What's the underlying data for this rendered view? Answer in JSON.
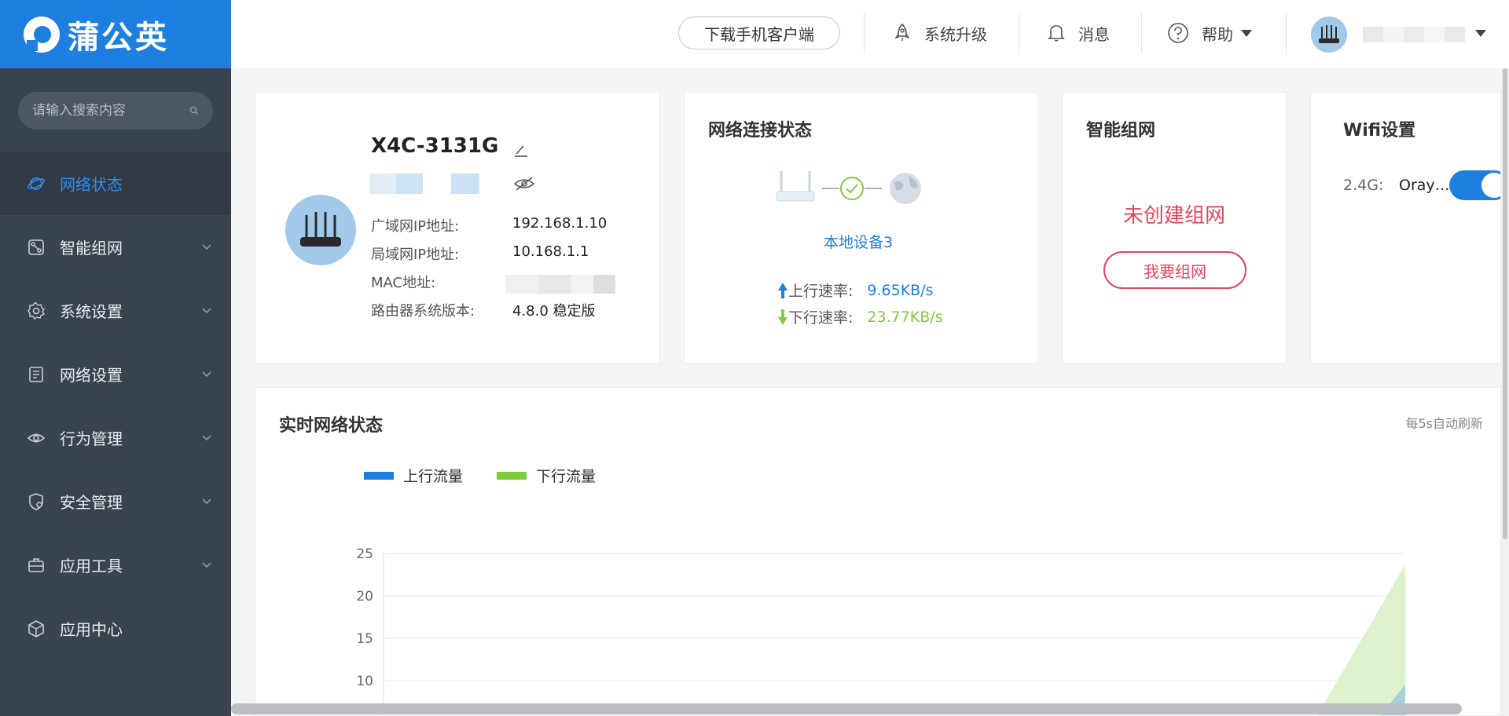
{
  "brand": {
    "name": "蒲公英"
  },
  "sidebar": {
    "search_placeholder": "请输入搜索内容",
    "items": [
      {
        "label": "网络状态",
        "icon": "planet-icon",
        "active": true
      },
      {
        "label": "智能组网",
        "icon": "mesh-icon"
      },
      {
        "label": "系统设置",
        "icon": "gear-icon"
      },
      {
        "label": "网络设置",
        "icon": "document-icon"
      },
      {
        "label": "行为管理",
        "icon": "eye-icon"
      },
      {
        "label": "安全管理",
        "icon": "shield-gear-icon"
      },
      {
        "label": "应用工具",
        "icon": "briefcase-icon"
      },
      {
        "label": "应用中心",
        "icon": "cube-icon"
      }
    ]
  },
  "header": {
    "download_label": "下载手机客户端",
    "upgrade_label": "系统升级",
    "messages_label": "消息",
    "help_label": "帮助"
  },
  "device_card": {
    "name": "X4C-3131G",
    "wan_label": "广域网IP地址:",
    "wan_value": "192.168.1.10",
    "lan_label": "局域网IP地址:",
    "lan_value": "10.168.1.1",
    "mac_label": "MAC地址:",
    "version_label": "路由器系统版本:",
    "version_value": "4.8.0 稳定版"
  },
  "network_card": {
    "title": "网络连接状态",
    "device_link": "本地设备3",
    "up_label": "上行速率:",
    "up_value": "9.65KB/s",
    "down_label": "下行速率:",
    "down_value": "23.77KB/s"
  },
  "mesh_card": {
    "title": "智能组网",
    "status": "未创建组网",
    "button": "我要组网"
  },
  "wifi_card": {
    "title": "Wifi设置",
    "band_label": "2.4G:",
    "ssid": "Oray…",
    "enabled": true
  },
  "realtime": {
    "title": "实时网络状态",
    "refresh_note": "每5s自动刷新"
  },
  "colors": {
    "accent": "#1d7fe0",
    "up": "#1d7fe0",
    "down": "#7ecb3c",
    "alert": "#e6455a"
  },
  "chart_data": {
    "type": "area",
    "series": [
      {
        "name": "上行流量"
      },
      {
        "name": "下行流量"
      }
    ],
    "yticks": [
      "25",
      "20",
      "15",
      "10"
    ],
    "ylim": [
      0,
      25
    ]
  }
}
